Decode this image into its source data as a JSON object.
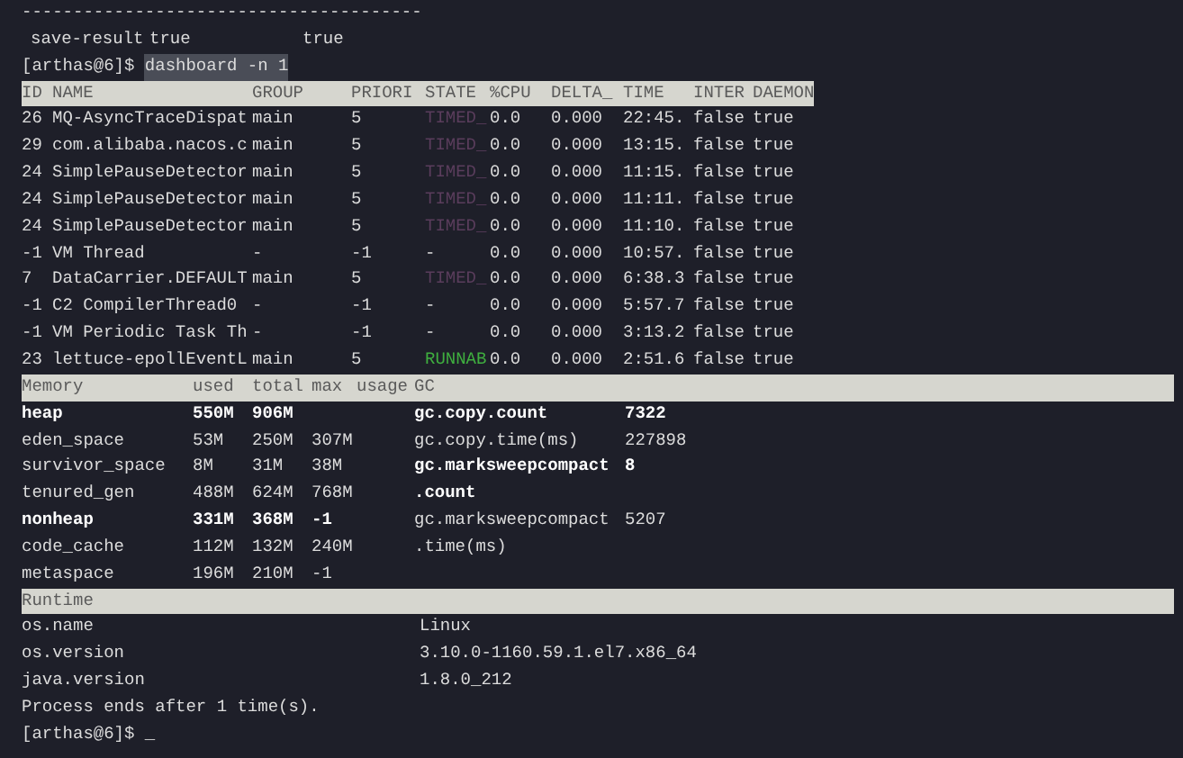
{
  "divider_text": "---------------------------------------",
  "save_result": [
    "save-result",
    "true",
    "true"
  ],
  "prompt_1": {
    "prompt": "[arthas@6]$",
    "command": "dashboard -n 1"
  },
  "threads": {
    "columns": [
      "ID",
      "NAME",
      "GROUP",
      "PRIORI",
      "STATE",
      "%CPU",
      "DELTA_",
      "TIME",
      "INTER",
      "DAEMON"
    ],
    "rows": [
      {
        "id": "26",
        "name": "MQ-AsyncTraceDispat",
        "group": "main",
        "priority": "5",
        "state": "TIMED_",
        "color": "#5a3d5c",
        "cpu": "0.0",
        "delta": "0.000",
        "time": "22:45.",
        "interrupted": "false",
        "daemon": "true"
      },
      {
        "id": "29",
        "name": "com.alibaba.nacos.c",
        "group": "main",
        "priority": "5",
        "state": "TIMED_",
        "color": "#5a3d5c",
        "cpu": "0.0",
        "delta": "0.000",
        "time": "13:15.",
        "interrupted": "false",
        "daemon": "true"
      },
      {
        "id": "24",
        "name": "SimplePauseDetector",
        "group": "main",
        "priority": "5",
        "state": "TIMED_",
        "color": "#5a3d5c",
        "cpu": "0.0",
        "delta": "0.000",
        "time": "11:15.",
        "interrupted": "false",
        "daemon": "true"
      },
      {
        "id": "24",
        "name": "SimplePauseDetector",
        "group": "main",
        "priority": "5",
        "state": "TIMED_",
        "color": "#5a3d5c",
        "cpu": "0.0",
        "delta": "0.000",
        "time": "11:11.",
        "interrupted": "false",
        "daemon": "true"
      },
      {
        "id": "24",
        "name": "SimplePauseDetector",
        "group": "main",
        "priority": "5",
        "state": "TIMED_",
        "color": "#5a3d5c",
        "cpu": "0.0",
        "delta": "0.000",
        "time": "11:10.",
        "interrupted": "false",
        "daemon": "true"
      },
      {
        "id": "-1",
        "name": "VM Thread",
        "group": "-",
        "priority": "-1",
        "state": "-",
        "cpu": "0.0",
        "delta": "0.000",
        "time": "10:57.",
        "interrupted": "false",
        "daemon": "true"
      },
      {
        "id": "7",
        "name": "DataCarrier.DEFAULT",
        "group": "main",
        "priority": "5",
        "state": "TIMED_",
        "color": "#5a3d5c",
        "cpu": "0.0",
        "delta": "0.000",
        "time": "6:38.3",
        "interrupted": "false",
        "daemon": "true"
      },
      {
        "id": "-1",
        "name": "C2 CompilerThread0",
        "group": "-",
        "priority": "-1",
        "state": "-",
        "cpu": "0.0",
        "delta": "0.000",
        "time": "5:57.7",
        "interrupted": "false",
        "daemon": "true"
      },
      {
        "id": "-1",
        "name": "VM Periodic Task Th",
        "group": "-",
        "priority": "-1",
        "state": "-",
        "cpu": "0.0",
        "delta": "0.000",
        "time": "3:13.2",
        "interrupted": "false",
        "daemon": "true"
      },
      {
        "id": "23",
        "name": "lettuce-epollEventL",
        "group": "main",
        "priority": "5",
        "state": "RUNNAB",
        "color": "#3fae3f",
        "cpu": "0.0",
        "delta": "0.000",
        "time": "2:51.6",
        "interrupted": "false",
        "daemon": "true"
      }
    ]
  },
  "memory": {
    "columns": [
      "Memory",
      "used",
      "total",
      "max",
      "usage",
      "GC"
    ],
    "rows": [
      {
        "name": "heap",
        "used": "550M",
        "total": "906M",
        "bold": true
      },
      {
        "name": "eden_space",
        "used": "53M",
        "total": "250M",
        "max": "307M",
        "bold": false
      },
      {
        "name": "survivor_space",
        "used": "8M",
        "total": "31M",
        "max": "38M",
        "bold": false
      },
      {
        "name": "tenured_gen",
        "used": "488M",
        "total": "624M",
        "max": "768M",
        "bold": false
      },
      {
        "name": "nonheap",
        "used": "331M",
        "total": "368M",
        "max": "-1",
        "bold": true
      },
      {
        "name": "code_cache",
        "used": "112M",
        "total": "132M",
        "max": "240M",
        "bold": false
      },
      {
        "name": "metaspace",
        "used": "196M",
        "total": "210M",
        "max": "-1",
        "bold": false
      }
    ],
    "gc": [
      {
        "name": "gc.copy.count",
        "value": "7322",
        "bold": true
      },
      {
        "name": "gc.copy.time(ms)",
        "value": "227898",
        "bold": false
      },
      {
        "name": "gc.marksweepcompact",
        "value": "8",
        "bold": true
      },
      {
        "name": ".count",
        "bold": true
      },
      {
        "name": "gc.marksweepcompact",
        "value": "5207",
        "bold": false
      },
      {
        "name": ".time(ms)",
        "bold": false
      }
    ]
  },
  "runtime": {
    "title": "Runtime",
    "rows": [
      {
        "key": "os.name",
        "value": "Linux"
      },
      {
        "key": "os.version",
        "value": "3.10.0-1160.59.1.el7.x86_64"
      },
      {
        "key": "java.version",
        "value": "1.8.0_212"
      }
    ]
  },
  "message": "Process ends after 1 time(s).",
  "prompt_2": {
    "prompt": "[arthas@6]$",
    "cursor": "_"
  }
}
